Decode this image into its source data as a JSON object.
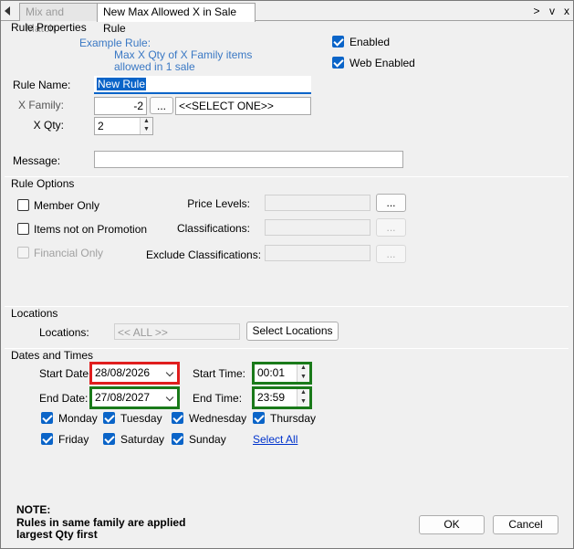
{
  "tabs": {
    "inactive": "Mix and Match",
    "active": "New Max Allowed X in Sale Rule",
    "controls": [
      ">",
      "v",
      "x"
    ]
  },
  "rule_properties": {
    "title": "Rule Properties",
    "example_label": "Example Rule:",
    "example_line1": "Max X Qty of X Family items",
    "example_line2": "allowed in 1 sale",
    "enabled_label": "Enabled",
    "enabled": true,
    "web_enabled_label": "Web Enabled",
    "web_enabled": true,
    "rule_name_label": "Rule Name:",
    "rule_name_value": "New Rule",
    "x_family_label": "X Family:",
    "x_family_value": "-2",
    "x_family_button": "...",
    "x_family_select": "<<SELECT ONE>>",
    "x_qty_label": "X Qty:",
    "x_qty_value": "2",
    "message_label": "Message:",
    "message_value": ""
  },
  "rule_options": {
    "title": "Rule Options",
    "member_only_label": "Member Only",
    "items_not_promo_label": "Items not on Promotion",
    "financial_only_label": "Financial Only",
    "price_levels_label": "Price Levels:",
    "classifications_label": "Classifications:",
    "exclude_classifications_label": "Exclude Classifications:",
    "ellipsis": "..."
  },
  "locations": {
    "title": "Locations",
    "label": "Locations:",
    "value": "<< ALL >>",
    "button": "Select Locations"
  },
  "dates": {
    "title": "Dates and Times",
    "start_date_label": "Start Date:",
    "start_date": "28/08/2026",
    "end_date_label": "End Date:",
    "end_date": "27/08/2027",
    "start_time_label": "Start Time:",
    "start_time": "00:01",
    "end_time_label": "End Time:",
    "end_time": "23:59",
    "days": [
      "Monday",
      "Tuesday",
      "Wednesday",
      "Thursday",
      "Friday",
      "Saturday",
      "Sunday"
    ],
    "select_all": "Select All"
  },
  "note": {
    "heading": "NOTE:",
    "line1": "Rules in same family are applied",
    "line2": "largest Qty first"
  },
  "footer": {
    "ok": "OK",
    "cancel": "Cancel"
  },
  "colors": {
    "accent": "#0a64c8",
    "highlight_red": "#e01e1e",
    "highlight_green": "#1a7a1a"
  }
}
